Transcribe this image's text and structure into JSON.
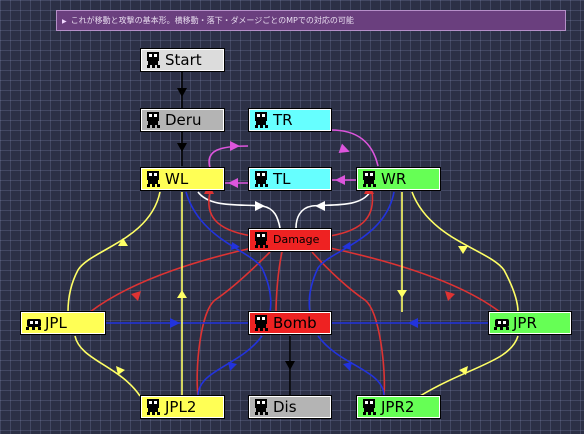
{
  "comment": {
    "text": "これが移動と攻撃の基本形。横移動・落下・ダメージごとのMPでの対応の可能"
  },
  "colors": {
    "start": "#dcdcdc",
    "gray": "#b4b4b4",
    "cyan": "#66ffff",
    "yellow": "#ffff55",
    "green": "#66ff55",
    "red": "#ee2222",
    "edge_black": "#000000",
    "edge_magenta": "#dd55dd",
    "edge_white": "#ffffff",
    "edge_red": "#dd3333",
    "edge_blue": "#2233dd",
    "edge_yellow": "#ffff66"
  },
  "nodes": {
    "start": {
      "label": "Start",
      "icon": "robot-icon"
    },
    "deru": {
      "label": "Deru",
      "icon": "robot-icon"
    },
    "tr": {
      "label": "TR",
      "icon": "robot-icon"
    },
    "wl": {
      "label": "WL",
      "icon": "robot-icon"
    },
    "tl": {
      "label": "TL",
      "icon": "robot-icon"
    },
    "wr": {
      "label": "WR",
      "icon": "robot-icon"
    },
    "damage": {
      "label": "Damage",
      "icon": "robot-icon"
    },
    "jpl": {
      "label": "JPL",
      "icon": "crawler-icon"
    },
    "bomb": {
      "label": "Bomb",
      "icon": "robot-icon"
    },
    "jpr": {
      "label": "JPR",
      "icon": "crawler-icon"
    },
    "jpl2": {
      "label": "JPL2",
      "icon": "robot-icon"
    },
    "dis": {
      "label": "Dis",
      "icon": "robot-icon"
    },
    "jpr2": {
      "label": "JPR2",
      "icon": "robot-icon"
    }
  }
}
